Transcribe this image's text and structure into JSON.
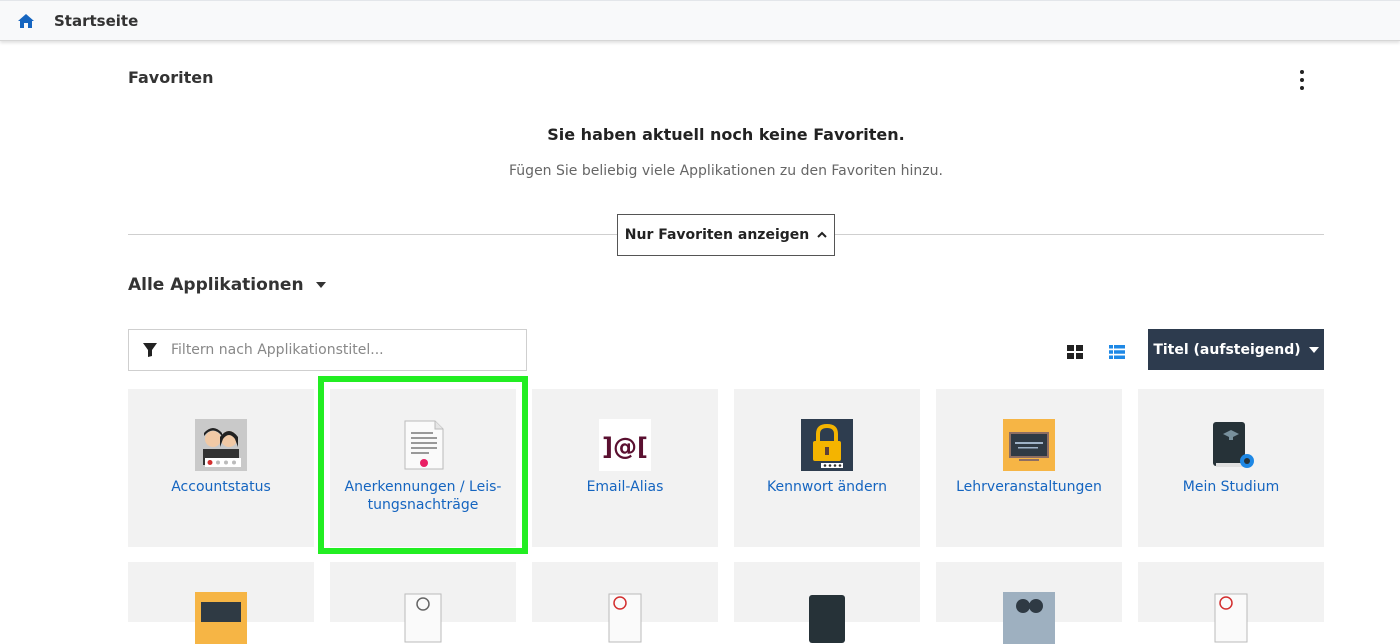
{
  "topbar": {
    "title": "Startseite"
  },
  "favorites": {
    "title": "Favoriten",
    "empty_heading": "Sie haben aktuell noch keine Favoriten.",
    "empty_sub": "Fügen Sie beliebig viele Applikationen zu den Favoriten hinzu.",
    "toggle_label": "Nur Favoriten anzeigen"
  },
  "apps": {
    "title": "Alle Applikationen",
    "filter_placeholder": "Filtern nach Applikationstitel...",
    "sort_label": "Titel (aufsteigend)",
    "tiles": [
      {
        "label": "Accountstatus",
        "icon": "accountstatus-icon"
      },
      {
        "label": "Anerkennungen / Leis-\ntungsnachträge",
        "icon": "document-icon"
      },
      {
        "label": "Email-Alias",
        "icon": "email-alias-icon"
      },
      {
        "label": "Kennwort ändern",
        "icon": "lock-icon"
      },
      {
        "label": "Lehrveranstaltungen",
        "icon": "chalkboard-icon"
      },
      {
        "label": "Mein Studium",
        "icon": "book-icon"
      }
    ]
  },
  "colors": {
    "accent": "#1565c0",
    "sort_button": "#2d3b4e",
    "highlight": "#22ee22",
    "tile_bg": "#f2f2f2"
  }
}
